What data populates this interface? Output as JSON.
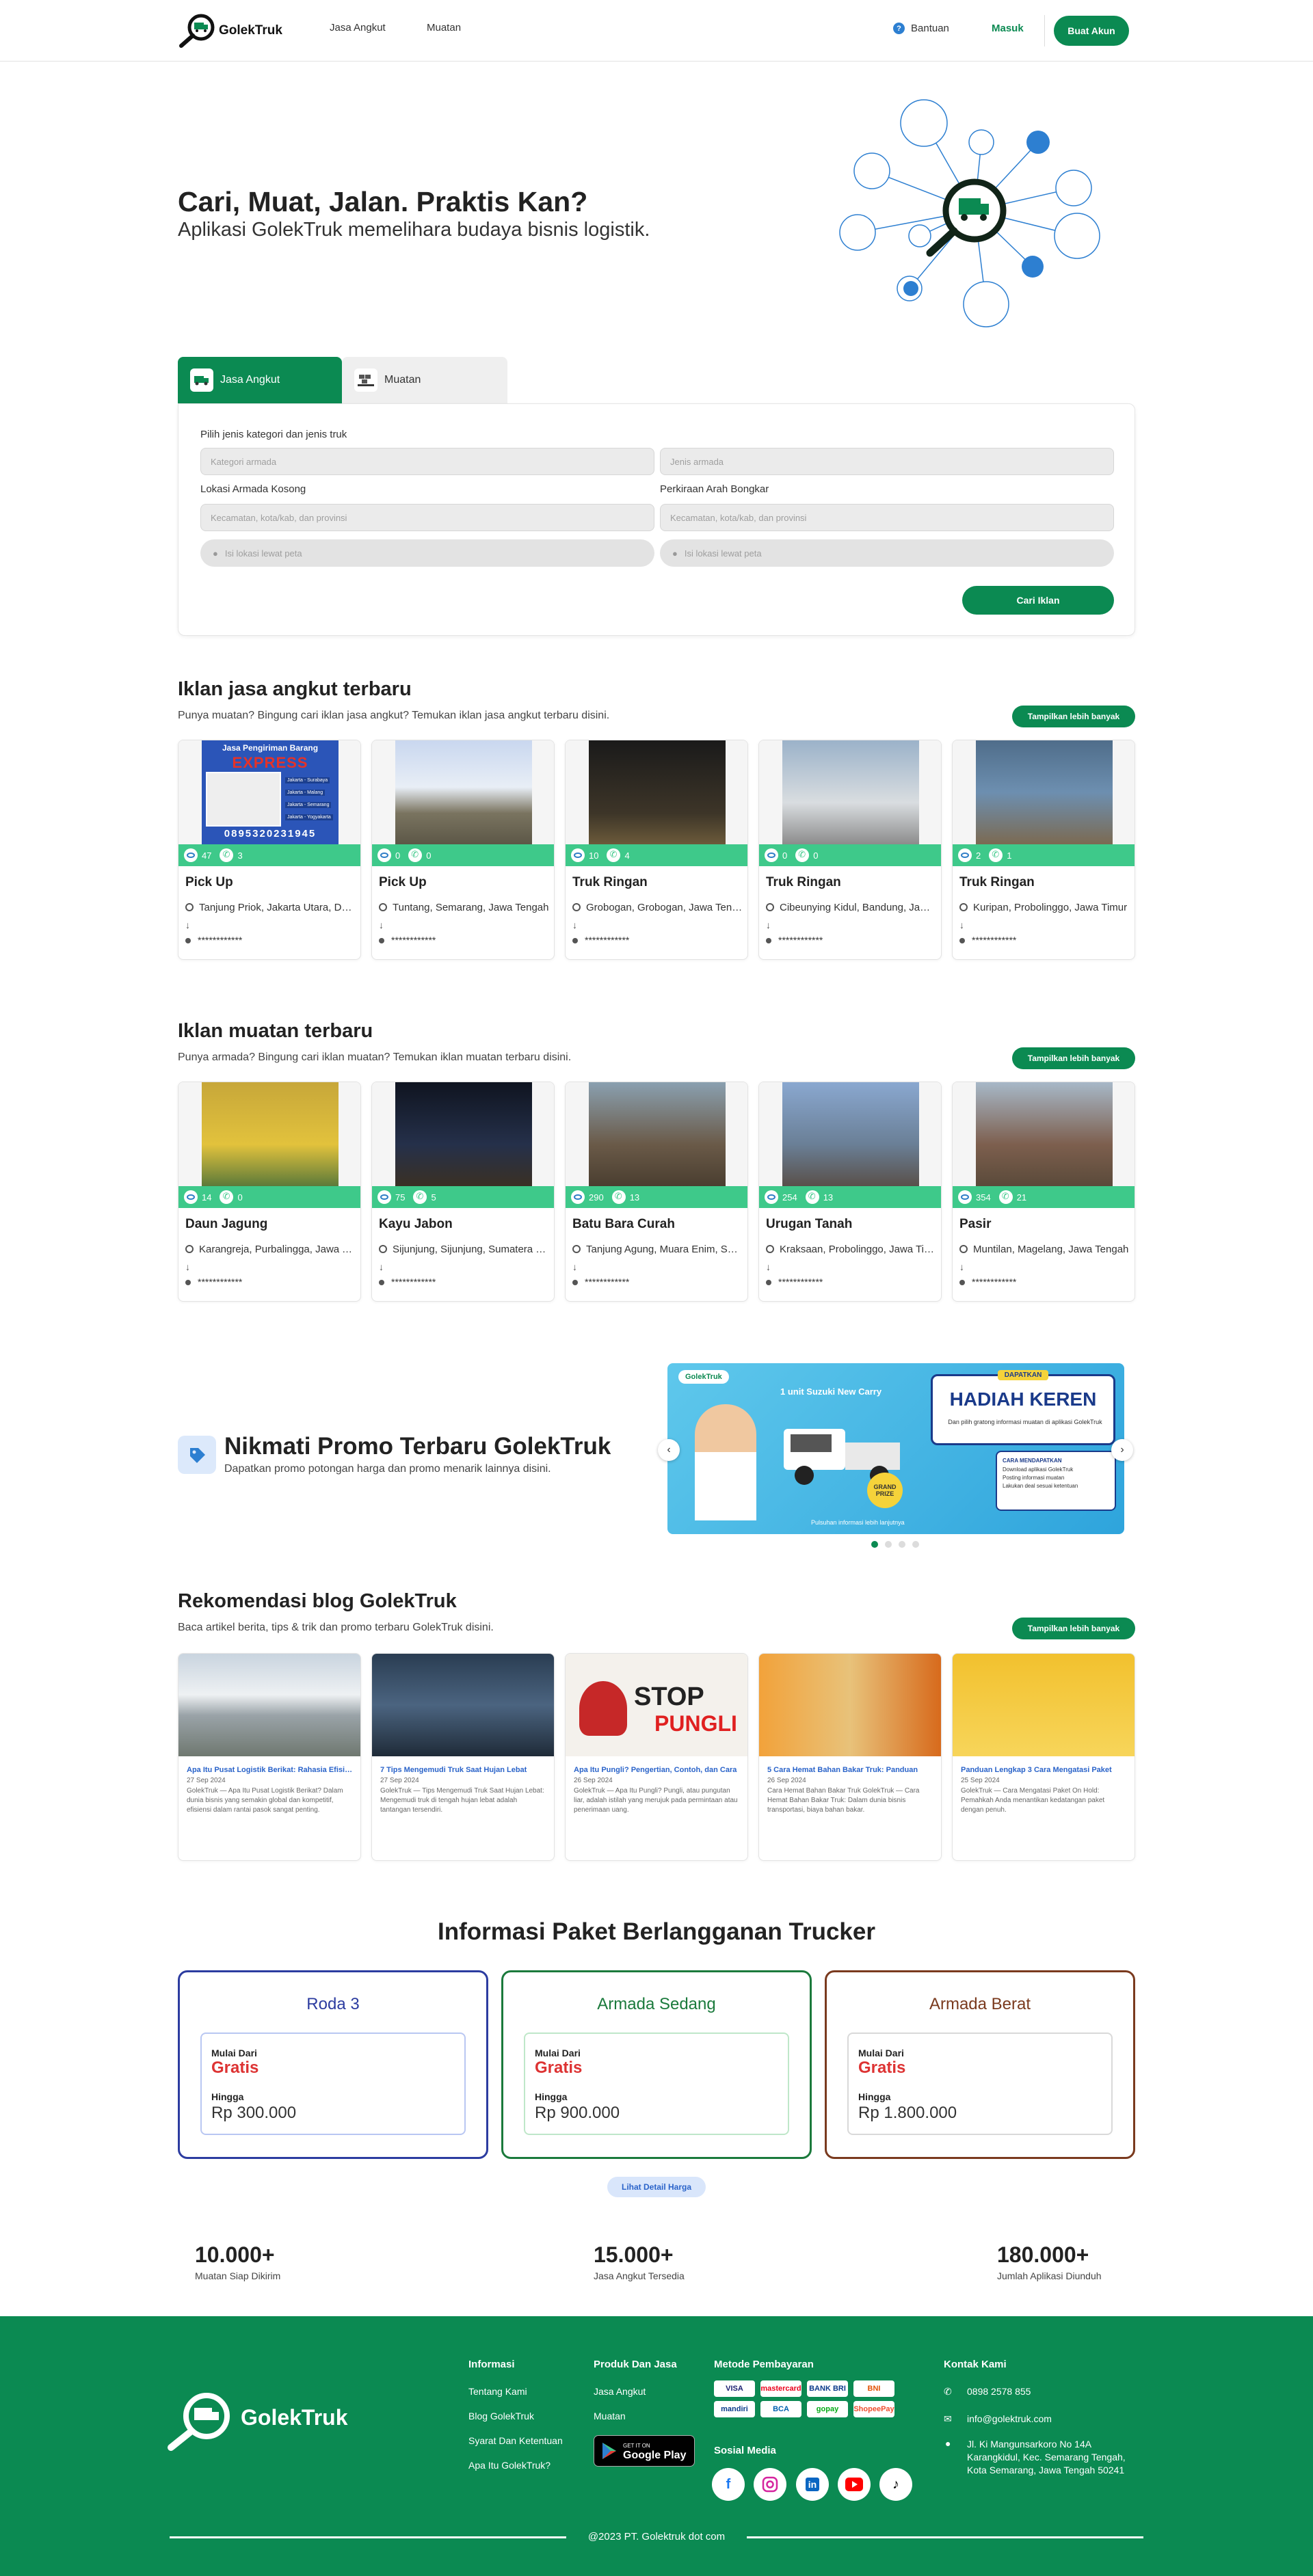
{
  "brand": {
    "name": "GolekTruk",
    "primary": "#0b8a52",
    "accent": "#3ec98a",
    "link": "#2a63c9"
  },
  "nav": {
    "jasa_angkut": "Jasa Angkut",
    "muatan": "Muatan",
    "bantuan": "Bantuan",
    "masuk": "Masuk",
    "buat_akun": "Buat Akun"
  },
  "hero": {
    "title": "Cari, Muat, Jalan. Praktis Kan?",
    "subtitle": "Aplikasi GolekTruk memelihara budaya bisnis logistik."
  },
  "search": {
    "tabs": [
      {
        "label": "Jasa Angkut",
        "icon": "truck-icon",
        "active": true
      },
      {
        "label": "Muatan",
        "icon": "cargo-icon",
        "active": false
      }
    ],
    "category_label": "Pilih jenis kategori dan jenis truk",
    "armada_placeholder": "Kategori armada",
    "jenis_placeholder": "Jenis armada",
    "lokasi_label": "Lokasi Armada Kosong",
    "bongkar_label": "Perkiraan Arah Bongkar",
    "lokasi_placeholder": "Kecamatan, kota/kab, dan provinsi",
    "bongkar_placeholder": "Kecamatan, kota/kab, dan provinsi",
    "map1": "Isi lokasi lewat peta",
    "map2": "Isi lokasi lewat peta",
    "submit": "Cari Iklan"
  },
  "jasa_section": {
    "title": "Iklan jasa angkut terbaru",
    "subtitle": "Punya muatan? Bingung cari iklan jasa angkut? Temukan iklan jasa angkut terbaru disini.",
    "more": "Tampilkan lebih banyak",
    "cards": [
      {
        "name": "Pick Up",
        "loc": "Tanjung Priok, Jakarta Utara, DKI Jakarta",
        "views": "47",
        "calls": "3",
        "hidden": "************",
        "banner_title": "Jasa Pengiriman Barang",
        "banner_big": "EXPRESS",
        "banner_phone": "0895320231945",
        "banner_routes": [
          "Jakarta - Surabaya",
          "Jakarta - Malang",
          "Jakarta - Semarang",
          "Jakarta - Yogyakarta"
        ]
      },
      {
        "name": "Pick Up",
        "loc": "Tuntang, Semarang, Jawa Tengah",
        "views": "0",
        "calls": "0",
        "hidden": "************"
      },
      {
        "name": "Truk Ringan",
        "loc": "Grobogan, Grobogan, Jawa Tengah",
        "views": "10",
        "calls": "4",
        "hidden": "************"
      },
      {
        "name": "Truk Ringan",
        "loc": "Cibeunying Kidul, Bandung, Jawa Barat",
        "views": "0",
        "calls": "0",
        "hidden": "************"
      },
      {
        "name": "Truk Ringan",
        "loc": "Kuripan, Probolinggo, Jawa Timur",
        "views": "2",
        "calls": "1",
        "hidden": "************"
      }
    ]
  },
  "muatan_section": {
    "title": "Iklan muatan terbaru",
    "subtitle": "Punya armada? Bingung cari iklan muatan? Temukan iklan muatan terbaru disini.",
    "more": "Tampilkan lebih banyak",
    "cards": [
      {
        "name": "Daun Jagung",
        "loc": "Karangreja, Purbalingga, Jawa Tengah",
        "views": "14",
        "calls": "0",
        "hidden": "************"
      },
      {
        "name": "Kayu Jabon",
        "loc": "Sijunjung, Sijunjung, Sumatera Barat",
        "views": "75",
        "calls": "5",
        "hidden": "************"
      },
      {
        "name": "Batu Bara Curah",
        "loc": "Tanjung Agung, Muara Enim, Sumatera Selatan",
        "views": "290",
        "calls": "13",
        "hidden": "************"
      },
      {
        "name": "Urugan Tanah",
        "loc": "Kraksaan, Probolinggo, Jawa Timur",
        "views": "254",
        "calls": "13",
        "hidden": "************"
      },
      {
        "name": "Pasir",
        "loc": "Muntilan, Magelang, Jawa Tengah",
        "views": "354",
        "calls": "21",
        "hidden": "************"
      }
    ]
  },
  "promo": {
    "title": "Nikmati Promo Terbaru GolekTruk",
    "subtitle": "Dapatkan promo potongan harga dan promo menarik lainnya disini.",
    "banner": {
      "brand": "GolekTruk",
      "line1": "1 unit Suzuki New Carry",
      "tag": "DAPATKAN",
      "headline": "HADIAH KEREN",
      "desc": "Dan pilih gratong informasi muatan di aplikasi GolekTruk",
      "grand": "GRAND PRIZE",
      "steps_title": "CARA MENDAPATKAN",
      "steps": [
        "Download aplikasi GolekTruk",
        "Posting informasi muatan",
        "Lakukan deal sesuai ketentuan"
      ],
      "foot": "Pulsuhan informasi lebih lanjutnya"
    },
    "slides": 4,
    "active_slide": 0
  },
  "blog": {
    "title": "Rekomendasi blog GolekTruk",
    "subtitle": "Baca artikel berita, tips & trik dan promo terbaru GolekTruk disini.",
    "more": "Tampilkan lebih banyak",
    "posts": [
      {
        "title": "Apa Itu Pusat Logistik Berikat: Rahasia Efisiensi",
        "date": "27 Sep 2024",
        "excerpt": "GolekTruk — Apa Itu Pusat Logistik Berikat? Dalam dunia bisnis yang semakin global dan kompetitif, efisiensi dalam rantai pasok sangat penting."
      },
      {
        "title": "7 Tips Mengemudi Truk Saat Hujan Lebat",
        "date": "27 Sep 2024",
        "excerpt": "GolekTruk — Tips Mengemudi Truk Saat Hujan Lebat: Mengemudi truk di tengah hujan lebat adalah tantangan tersendiri."
      },
      {
        "title": "Apa Itu Pungli? Pengertian, Contoh, dan Cara",
        "date": "26 Sep 2024",
        "excerpt": "GolekTruk — Apa Itu Pungli? Pungli, atau pungutan liar, adalah istilah yang merujuk pada permintaan atau penerimaan uang.",
        "img_word1": "STOP",
        "img_word2": "PUNGLI"
      },
      {
        "title": "5 Cara Hemat Bahan Bakar Truk: Panduan",
        "date": "26 Sep 2024",
        "excerpt": "Cara Hemat Bahan Bakar Truk GolekTruk — Cara Hemat Bahan Bakar Truk: Dalam dunia bisnis transportasi, biaya bahan bakar."
      },
      {
        "title": "Panduan Lengkap 3 Cara Mengatasi Paket",
        "date": "25 Sep 2024",
        "excerpt": "GolekTruk — Cara Mengatasi Paket On Hold: Pemahkah Anda menantikan kedatangan paket dengan penuh."
      }
    ]
  },
  "pricing": {
    "title": "Informasi Paket Berlangganan Trucker",
    "from_label": "Mulai Dari",
    "to_label": "Hingga",
    "plans": [
      {
        "name": "Roda 3",
        "from": "Gratis",
        "to": "Rp 300.000",
        "color": "#2c3ca0",
        "inner": "#b9c7f2"
      },
      {
        "name": "Armada Sedang",
        "from": "Gratis",
        "to": "Rp 900.000",
        "color": "#1b7a3c",
        "inner": "#bfe7c9"
      },
      {
        "name": "Armada Berat",
        "from": "Gratis",
        "to": "Rp 1.800.000",
        "color": "#7a3a1e",
        "inner": "#d9d9d9"
      }
    ],
    "detail": "Lihat Detail Harga"
  },
  "stats": [
    {
      "value": "10.000+",
      "label": "Muatan Siap Dikirim"
    },
    {
      "value": "15.000+",
      "label": "Jasa Angkut Tersedia"
    },
    {
      "value": "180.000+",
      "label": "Jumlah Aplikasi Diunduh"
    }
  ],
  "footer": {
    "brand": "GolekTruk",
    "info_title": "Informasi",
    "info_links": [
      "Tentang Kami",
      "Blog GolekTruk",
      "Syarat Dan Ketentuan",
      "Apa Itu GolekTruk?"
    ],
    "produk_title": "Produk Dan Jasa",
    "produk_links": [
      "Jasa Angkut",
      "Muatan"
    ],
    "gp_small": "GET IT ON",
    "gp_big": "Google Play",
    "bayar_title": "Metode Pembayaran",
    "payments": [
      "VISA",
      "mastercard",
      "BANK BRI",
      "BNI",
      "mandiri",
      "BCA",
      "gopay",
      "ShopeePay"
    ],
    "sosial_title": "Sosial Media",
    "kontak_title": "Kontak Kami",
    "phone": "0898 2578 855",
    "email": "info@golektruk.com",
    "address1": "Jl. Ki Mangunsarkoro No 14A",
    "address2": "Karangkidul, Kec. Semarang Tengah,",
    "address3": "Kota Semarang, Jawa Tengah 50241",
    "copyright": "@2023 PT. Golektruk dot com"
  }
}
